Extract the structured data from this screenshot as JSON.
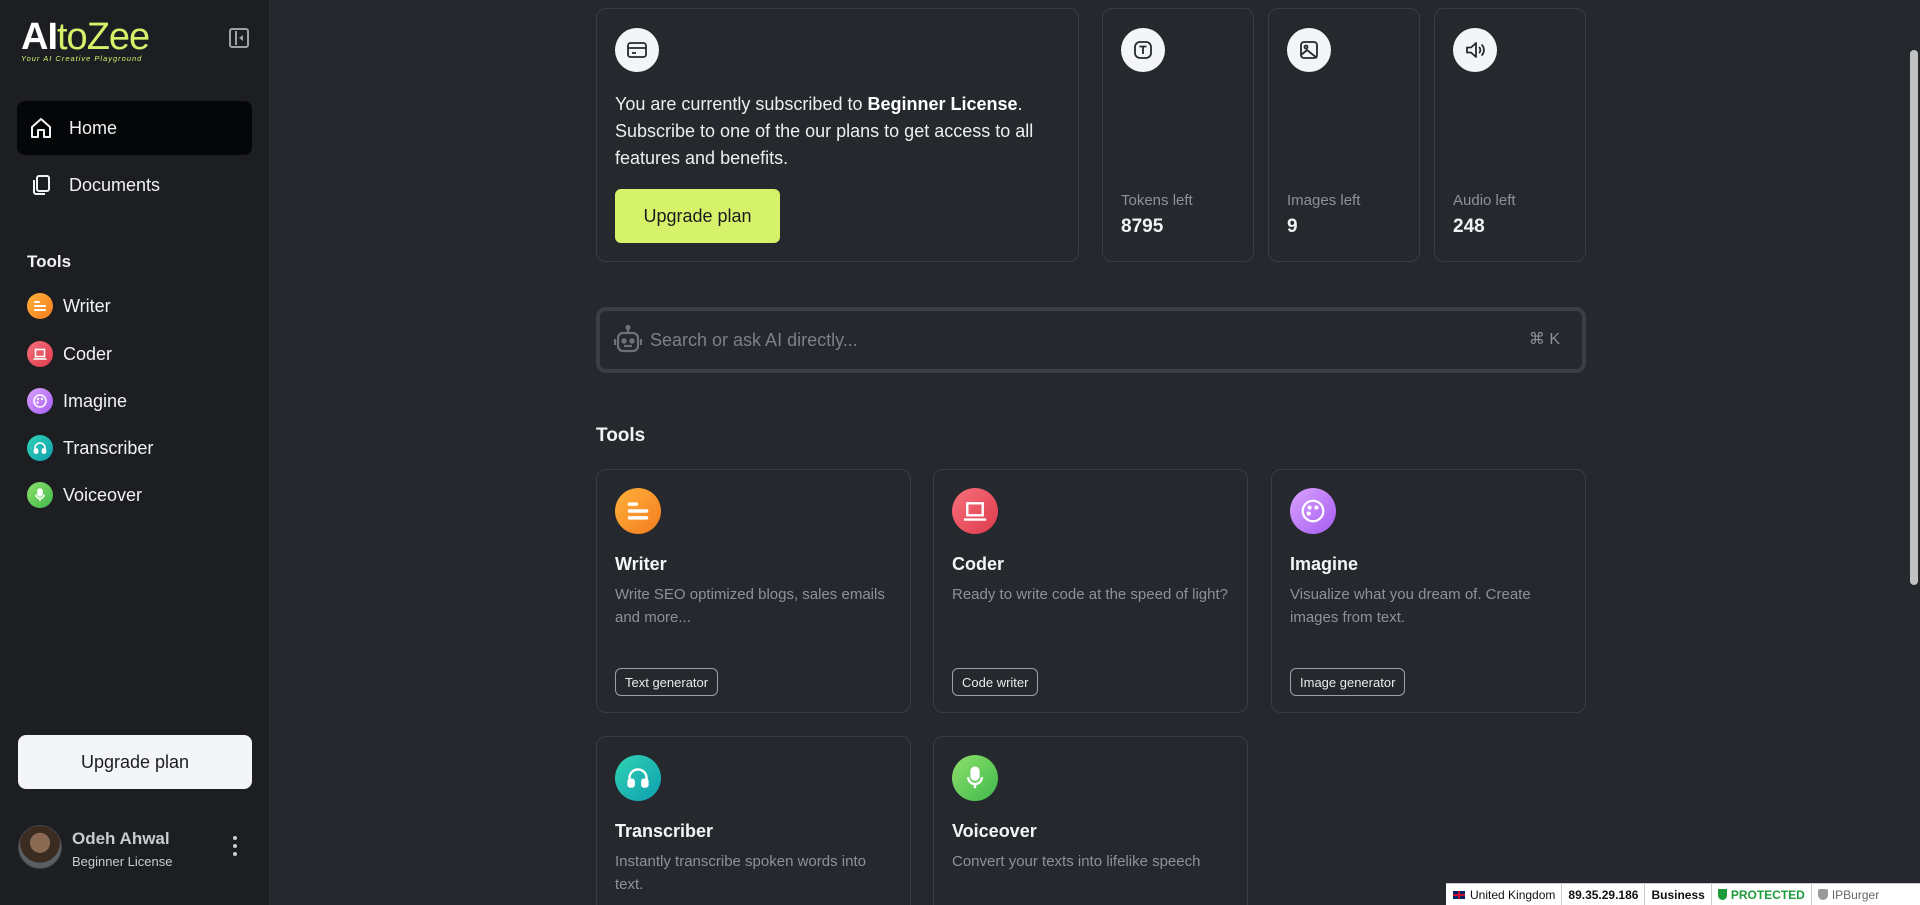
{
  "sidebar": {
    "logo_ai": "AI",
    "logo_rest": "toZee",
    "logo_tagline": "Your AI Creative Playground",
    "nav": [
      {
        "label": "Home",
        "icon": "home-icon",
        "active": true
      },
      {
        "label": "Documents",
        "icon": "documents-icon",
        "active": false
      }
    ],
    "tools_heading": "Tools",
    "tools": [
      {
        "label": "Writer",
        "icon": "writer-icon",
        "color": "#f59a2a"
      },
      {
        "label": "Coder",
        "icon": "laptop-icon",
        "color": "#e8505f"
      },
      {
        "label": "Imagine",
        "icon": "palette-icon",
        "color": "#b97af5"
      },
      {
        "label": "Transcriber",
        "icon": "headphones-icon",
        "color": "#1fb9b2"
      },
      {
        "label": "Voiceover",
        "icon": "microphone-icon",
        "color": "#62cd56"
      }
    ],
    "upgrade_label": "Upgrade plan",
    "user": {
      "name": "Odeh Ahwal",
      "plan": "Beginner License"
    }
  },
  "subscription": {
    "text_before": "You are currently subscribed to ",
    "license": "Beginner License",
    "text_after": ". Subscribe to one of the our plans to get access to all features and benefits.",
    "button": "Upgrade plan"
  },
  "stats": [
    {
      "label": "Tokens left",
      "value": "8795",
      "icon": "text-token-icon"
    },
    {
      "label": "Images left",
      "value": "9",
      "icon": "image-icon"
    },
    {
      "label": "Audio left",
      "value": "248",
      "icon": "speaker-icon"
    }
  ],
  "search": {
    "placeholder": "Search or ask AI directly...",
    "shortcut": "⌘ K"
  },
  "tools_section": {
    "title": "Tools",
    "cards": [
      {
        "title": "Writer",
        "desc": "Write SEO optimized blogs, sales emails and more...",
        "tag": "Text generator"
      },
      {
        "title": "Coder",
        "desc": "Ready to write code at the speed of light?",
        "tag": "Code writer"
      },
      {
        "title": "Imagine",
        "desc": "Visualize what you dream of. Create images from text.",
        "tag": "Image generator"
      },
      {
        "title": "Transcriber",
        "desc": "Instantly transcribe spoken words into text.",
        "tag": ""
      },
      {
        "title": "Voiceover",
        "desc": "Convert your texts into lifelike speech",
        "tag": ""
      }
    ]
  },
  "status_bar": {
    "country": "United Kingdom",
    "ip": "89.35.29.186",
    "type": "Business",
    "protection": "PROTECTED",
    "brand": "IPBurger"
  },
  "colors": {
    "accent": "#d6f26a",
    "background": "#25282d",
    "sidebar": "#1c1e22"
  }
}
